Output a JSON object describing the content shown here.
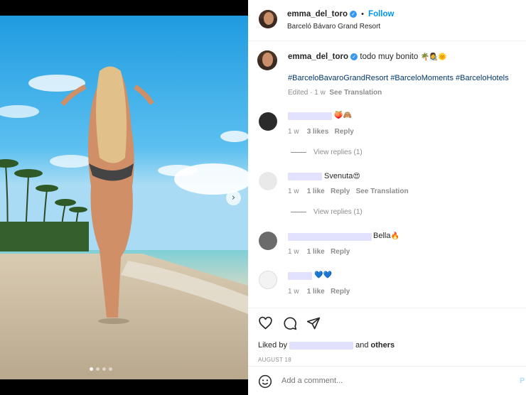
{
  "post": {
    "username": "emma_del_toro",
    "follow_label": "Follow",
    "location": "Barceló Bávaro Grand Resort",
    "caption": "todo muy bonito",
    "caption_emojis": "🌴👩‍🎨🌞",
    "hashtags": [
      "#BarceloBavaroGrandResort",
      "#BarceloMoments",
      "#BarceloHotels"
    ],
    "caption_meta": "Edited · 1 w",
    "see_translation": "See Translation"
  },
  "comments": [
    {
      "text": "",
      "emojis": "🍑🙈",
      "time": "1 w",
      "likes": "3 likes",
      "reply": "Reply",
      "view_replies": "View replies (1)"
    },
    {
      "text": "Svenuta",
      "emojis": "😍",
      "time": "1 w",
      "likes": "1 like",
      "reply": "Reply",
      "see_translation": "See Translation",
      "view_replies": "View replies (1)"
    },
    {
      "text": "Bella",
      "emojis": "🔥",
      "time": "1 w",
      "likes": "1 like",
      "reply": "Reply"
    },
    {
      "text": "",
      "emojis": "💙💙",
      "time": "1 w",
      "likes": "1 like",
      "reply": "Reply"
    }
  ],
  "likes": {
    "prefix": "Liked by",
    "suffix": "and",
    "others": "others"
  },
  "date": "AUGUST 18",
  "comment_box": {
    "placeholder": "Add a comment...",
    "post_label": "P"
  },
  "icons": [
    "like-icon",
    "comment-icon",
    "share-icon",
    "emoji-icon",
    "verified-icon",
    "next-arrow-icon"
  ],
  "colors": {
    "accent": "#0095f6",
    "hashtag": "#00376b",
    "muted": "#8e8e8e",
    "redaction": "#e2e2ff"
  }
}
